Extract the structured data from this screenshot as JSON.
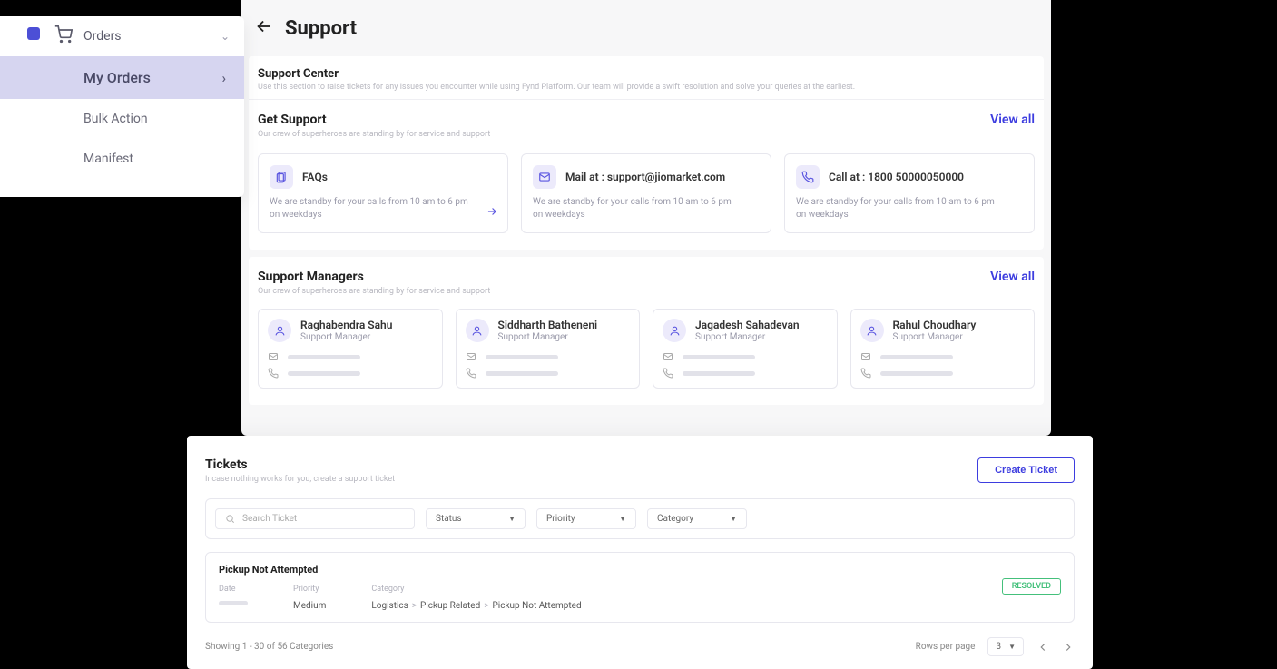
{
  "sidebar": {
    "top_label": "Orders",
    "items": [
      {
        "label": "My Orders",
        "active": true
      },
      {
        "label": "Bulk Action",
        "active": false
      },
      {
        "label": "Manifest",
        "active": false
      }
    ]
  },
  "header": {
    "title": "Support"
  },
  "support_center": {
    "title": "Support Center",
    "subtitle": "Use this section to raise tickets for any issues you encounter while using Fynd Platform. Our team will provide a swift resolution and solve your queries at the earliest."
  },
  "get_support": {
    "title": "Get Support",
    "subtitle": "Our crew of superheroes are standing by  for service and support",
    "view_all": "View all",
    "cards": [
      {
        "title": "FAQs",
        "body": "We are standby for your calls from 10 am to 6 pm on weekdays",
        "icon": "faq",
        "arrow": true
      },
      {
        "title": "Mail at : support@jiomarket.com",
        "body": "We are standby for your calls from 10 am to 6 pm on weekdays",
        "icon": "mail",
        "arrow": false
      },
      {
        "title": "Call at : 1800 50000050000",
        "body": "We are standby for your calls from 10 am to 6 pm on weekdays",
        "icon": "phone",
        "arrow": false
      }
    ]
  },
  "managers": {
    "title": "Support Managers",
    "subtitle": "Our crew of superheroes are standing by  for service and support",
    "view_all": "View all",
    "items": [
      {
        "name": "Raghabendra Sahu",
        "role": "Support Manager"
      },
      {
        "name": "Siddharth Batheneni",
        "role": "Support Manager"
      },
      {
        "name": "Jagadesh Sahadevan",
        "role": "Support Manager"
      },
      {
        "name": "Rahul Choudhary",
        "role": "Support Manager"
      }
    ]
  },
  "tickets": {
    "title": "Tickets",
    "subtitle": "Incase nothing works for you, create a support ticket",
    "create_label": "Create Ticket",
    "search_placeholder": "Search Ticket",
    "filters": {
      "status": "Status",
      "priority": "Priority",
      "category": "Category"
    },
    "ticket": {
      "title": "Pickup Not Attempted",
      "date_label": "Date",
      "priority_label": "Priority",
      "priority_value": "Medium",
      "category_label": "Category",
      "category_path": [
        "Logistics",
        "Pickup Related",
        "Pickup Not Attempted"
      ],
      "status": "RESOLVED"
    },
    "footer": {
      "showing": "Showing 1 - 30 of 56 Categories",
      "rows_label": "Rows per page",
      "rows_value": "3"
    }
  }
}
